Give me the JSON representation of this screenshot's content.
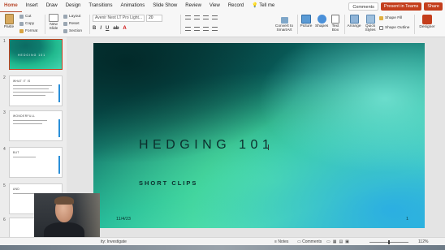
{
  "ribbon_tabs": [
    "Home",
    "Insert",
    "Draw",
    "Design",
    "Transitions",
    "Animations",
    "Slide Show",
    "Review",
    "View",
    "Record",
    "Tell me"
  ],
  "top_buttons": {
    "comments": "Comments",
    "present": "Present in Teams",
    "share": "Share"
  },
  "ribbon": {
    "paste": "Paste",
    "cut": "Cut",
    "copy": "Copy",
    "format": "Format",
    "new_slide": "New Slide",
    "layout": "Layout",
    "reset": "Reset",
    "section": "Section",
    "font_name": "Avenir Next LT Pro Light...",
    "font_size": "20",
    "convert_smartart": "Convert to SmartArt",
    "picture": "Picture",
    "shapes": "Shapes",
    "text_box": "Text Box",
    "arrange": "Arrange",
    "quick_styles": "Quick Styles",
    "shape_fill": "Shape Fill",
    "shape_outline": "Shape Outline",
    "designer": "Designer"
  },
  "thumbnails": [
    {
      "number": "1",
      "title": "HEDGING 101",
      "selected": true
    },
    {
      "number": "2",
      "title": "WHAT IT IS",
      "selected": false
    },
    {
      "number": "3",
      "title": "WONDERFULL",
      "selected": false
    },
    {
      "number": "4",
      "title": "BUT",
      "selected": false
    },
    {
      "number": "5",
      "title": "AND",
      "selected": false
    },
    {
      "number": "6",
      "title": "",
      "selected": false
    }
  ],
  "slide": {
    "title": "HEDGING 101",
    "subtitle": "SHORT CLIPS",
    "date": "11/4/23",
    "number": "1"
  },
  "status_bar": {
    "accessibility": "ity: Investigate",
    "notes": "Notes",
    "comments": "Comments",
    "zoom": "112%"
  },
  "colors": {
    "accent": "#c43e1c",
    "slide_teal_dark": "#063b3b",
    "slide_green": "#4fe0b7"
  }
}
